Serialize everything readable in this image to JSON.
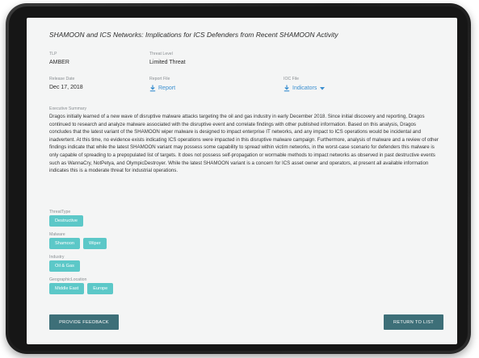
{
  "report": {
    "title": "SHAMOON and ICS Networks: Implications for ICS Defenders from Recent SHAMOON Activity"
  },
  "fields": {
    "tlp": {
      "label": "TLP",
      "value": "AMBER"
    },
    "threat_level": {
      "label": "Threat Level",
      "value": "Limited Threat"
    },
    "release_date": {
      "label": "Release Date",
      "value": "Dec 17, 2018"
    },
    "report_file": {
      "label": "Report File",
      "link_text": "Report"
    },
    "ioc_file": {
      "label": "IOC File",
      "link_text": "Indicators"
    }
  },
  "summary": {
    "label": "Executive Summary",
    "text": "Dragos initially learned of a new wave of disruptive malware attacks targeting the oil and gas industry in early December 2018. Since initial discovery and reporting, Dragos continued to research and analyze malware associated with the disruptive event and correlate findings with other published information. Based on this analysis, Dragos concludes that the latest variant of the SHAMOON wiper malware is designed to impact enterprise IT networks, and any impact to ICS operations would be incidental and inadvertent. At this time, no evidence exists indicating ICS operations were impacted in this disruptive malware campaign. Furthermore, analysis of malware and a review of other findings indicate that while the latest SHAMOON variant may possess some capability to spread within victim networks, in the worst-case scenario for defenders this malware is only capable of spreading to a prepopulated list of targets. It does not possess self-propagation or wormable methods to impact networks as observed in past destructive events such as WannaCry, NotPetya, and OlympicDestroyer. While the latest SHAMOON variant is a concern for ICS asset owner and operators, at present all available information indicates this is a moderate threat for industrial operations."
  },
  "tag_groups": {
    "threat_type": {
      "label": "ThreatType",
      "tags": [
        "Destructive"
      ]
    },
    "malware": {
      "label": "Malware",
      "tags": [
        "Shamoon",
        "Wiper"
      ]
    },
    "industry": {
      "label": "Industry",
      "tags": [
        "Oil & Gas"
      ]
    },
    "geographic_location": {
      "label": "GeographicLocation",
      "tags": [
        "Middle East",
        "Europe"
      ]
    }
  },
  "actions": {
    "feedback_label": "PROVIDE FEEDBACK",
    "return_label": "RETURN TO LIST"
  },
  "colors": {
    "accent_link": "#3a8fd0",
    "tag_bg": "#5cc8c8",
    "button_bg": "#3d6f78",
    "screen_bg": "#f4f5f5"
  },
  "icons": {
    "report_file": "download-icon",
    "ioc_file": "download-icon",
    "ioc_dropdown": "chevron-down-icon"
  }
}
